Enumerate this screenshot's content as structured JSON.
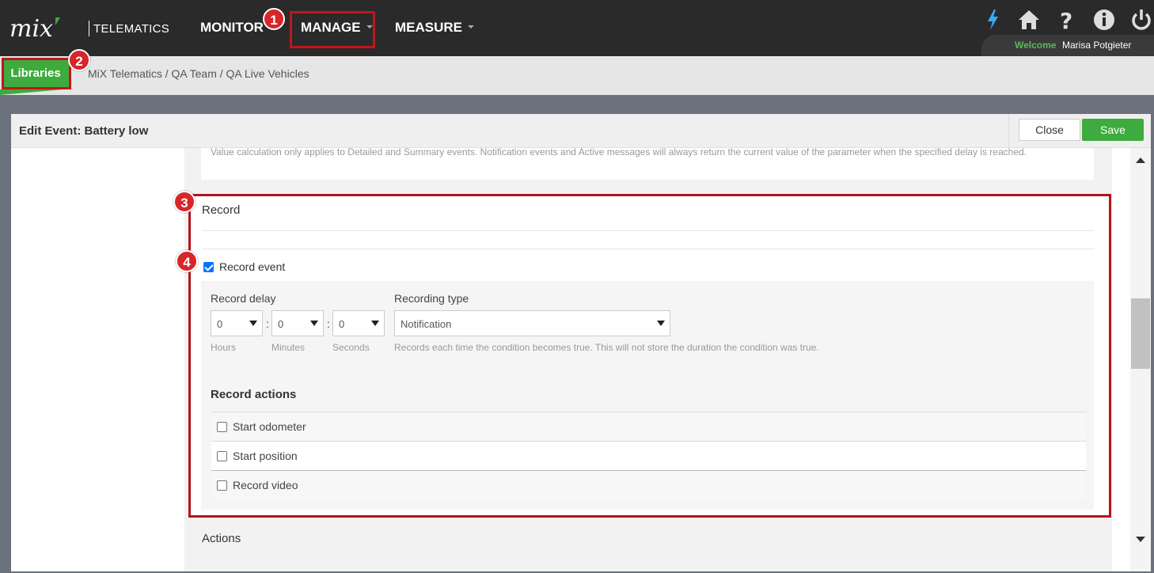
{
  "app": {
    "logo_text": "mix",
    "logo_sub": "TELEMATICS"
  },
  "nav": {
    "monitor": "MONITOR",
    "manage": "MANAGE",
    "measure": "MEASURE"
  },
  "annotations": {
    "one": "1",
    "two": "2",
    "three": "3",
    "four": "4"
  },
  "user": {
    "welcome": "Welcome",
    "name": "Marisa Potgieter"
  },
  "icons": [
    "lightning-icon",
    "home-icon",
    "help-icon",
    "info-icon",
    "power-icon"
  ],
  "breadcrumb": {
    "libraries": "Libraries",
    "path": "MiX Telematics / QA Team / QA Live Vehicles"
  },
  "panel": {
    "title": "Edit Event: Battery low",
    "close": "Close",
    "save": "Save",
    "info_text": "Value calculation only applies to Detailed and Summary events. Notification events and Active messages will always return the current value of the parameter when the specified delay is reached."
  },
  "record": {
    "title": "Record",
    "record_event_label": "Record event",
    "record_event_checked": true,
    "record_delay_label": "Record delay",
    "hours_value": "0",
    "minutes_value": "0",
    "seconds_value": "0",
    "colon": ":",
    "hours_label": "Hours",
    "minutes_label": "Minutes",
    "seconds_label": "Seconds",
    "recording_type_label": "Recording type",
    "recording_type_value": "Notification",
    "recording_type_hint": "Records each time the condition becomes true. This will not store the duration the condition was true.",
    "record_actions_title": "Record actions",
    "actions": [
      {
        "label": "Start odometer",
        "checked": false
      },
      {
        "label": "Start position",
        "checked": false
      },
      {
        "label": "Record video",
        "checked": false
      }
    ]
  },
  "actions_section": {
    "title": "Actions"
  },
  "colors": {
    "accent_green": "#3dab3d",
    "annotation_red": "#c0161c",
    "topbar": "#2a2a2a"
  }
}
